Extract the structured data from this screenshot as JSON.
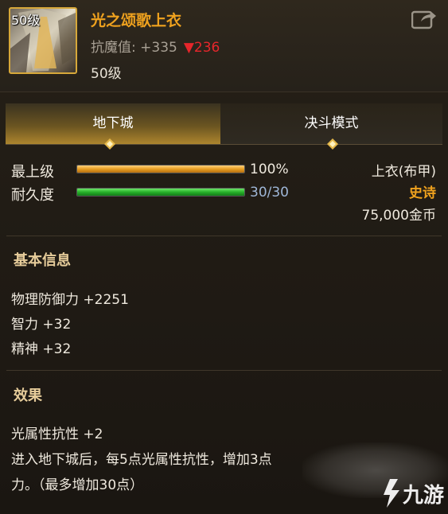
{
  "item": {
    "level_badge": "50级",
    "name": "光之颂歌上衣",
    "resist_label": "抗魔值: +335",
    "resist_down_symbol": "▼",
    "resist_down_value": "236",
    "required_level": "50级",
    "name_color": "#f0a21e"
  },
  "tabs": [
    {
      "label": "地下城",
      "active": true
    },
    {
      "label": "决斗模式",
      "active": false
    }
  ],
  "stats": {
    "upgrade_label": "最上级",
    "upgrade_value": "100%",
    "upgrade_fraction": 1.0,
    "durability_label": "耐久度",
    "durability_value": "30/30",
    "durability_fraction": 1.0
  },
  "meta": {
    "slot_type": "上衣(布甲)",
    "rarity": "史诗",
    "rarity_color": "#f0a21e",
    "price": "75,000金币"
  },
  "basic_info": {
    "title": "基本信息",
    "lines": [
      "物理防御力 +2251",
      "智力 +32",
      "精神 +32"
    ]
  },
  "effect": {
    "title": "效果",
    "lines": [
      "光属性抗性 +2",
      "进入地下城后，每5点光属性抗性，增加3点",
      "力。（最多增加30点）"
    ]
  },
  "watermark": "九游",
  "icons": [
    "share-icon",
    "item-armor-icon",
    "tab-diamond-icon",
    "down-triangle-icon"
  ]
}
